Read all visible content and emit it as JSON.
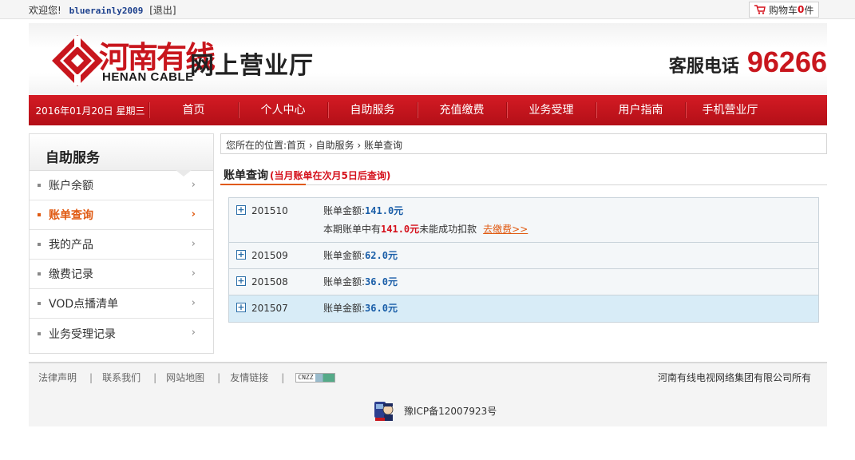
{
  "topbar": {
    "welcome": "欢迎您!",
    "username": "bluerainly2009",
    "logout": "[退出]",
    "cart_prefix": "购物车",
    "cart_count": "0",
    "cart_suffix": "件"
  },
  "header": {
    "logo_cn": "河南有线",
    "logo_en": "HENAN CABLE",
    "site_title": "网上营业厅",
    "hotline_label": "客服电话",
    "hotline_number": "96266"
  },
  "nav": {
    "date": "2016年01月20日  星期三",
    "items": [
      "首页",
      "个人中心",
      "自助服务",
      "充值缴费",
      "业务受理",
      "用户指南",
      "手机营业厅"
    ]
  },
  "sidebar": {
    "title": "自助服务",
    "items": [
      {
        "label": "账户余额",
        "active": false
      },
      {
        "label": "账单查询",
        "active": true
      },
      {
        "label": "我的产品",
        "active": false
      },
      {
        "label": "缴费记录",
        "active": false
      },
      {
        "label": "VOD点播清单",
        "active": false
      },
      {
        "label": "业务受理记录",
        "active": false
      }
    ]
  },
  "breadcrumb": {
    "prefix": "您所在的位置:",
    "parts": [
      "首页",
      "自助服务",
      "账单查询"
    ]
  },
  "section": {
    "title": "账单查询",
    "note": "(当月账单在次月5日后查询)"
  },
  "bills": {
    "amount_label": "账单金额:",
    "rows": [
      {
        "month": "201510",
        "amount": "141.0元",
        "unpaid_prefix": "本期账单中有",
        "unpaid_amount": "141.0元",
        "unpaid_suffix": "未能成功扣款",
        "pay_link": "去缴费>>"
      },
      {
        "month": "201509",
        "amount": "62.0元"
      },
      {
        "month": "201508",
        "amount": "36.0元"
      },
      {
        "month": "201507",
        "amount": "36.0元"
      }
    ]
  },
  "footer": {
    "links": [
      "法律声明",
      "联系我们",
      "网站地图",
      "友情链接"
    ],
    "cnzz": "CNZZ",
    "copyright": "河南有线电视网络集团有限公司所有",
    "icp": "豫ICP备12007923号"
  },
  "colors": {
    "brand_red": "#c8161d",
    "nav_red": "#c4141c",
    "active_orange": "#e05a12",
    "amount_blue": "#1a5ea8"
  }
}
